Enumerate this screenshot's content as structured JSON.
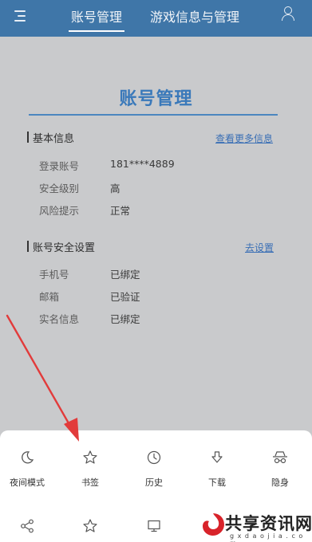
{
  "topbar": {
    "tabs": [
      {
        "label": "账号管理",
        "active": true
      },
      {
        "label": "游戏信息与管理",
        "active": false
      }
    ]
  },
  "main": {
    "title": "账号管理",
    "basic": {
      "heading": "基本信息",
      "link": "查看更多信息",
      "rows": [
        {
          "label": "登录账号",
          "value": "181****4889"
        },
        {
          "label": "安全级别",
          "value": "高"
        },
        {
          "label": "风险提示",
          "value": "正常"
        }
      ]
    },
    "security": {
      "heading": "账号安全设置",
      "link": "去设置",
      "rows": [
        {
          "label": "手机号",
          "value": "已绑定"
        },
        {
          "label": "邮箱",
          "value": "已验证"
        },
        {
          "label": "实名信息",
          "value": "已绑定"
        }
      ]
    }
  },
  "sheet": {
    "actions": [
      {
        "label": "夜间模式",
        "icon": "moon-icon"
      },
      {
        "label": "书签",
        "icon": "star-icon"
      },
      {
        "label": "历史",
        "icon": "clock-icon"
      },
      {
        "label": "下载",
        "icon": "download-icon"
      },
      {
        "label": "隐身",
        "icon": "incognito-icon"
      }
    ],
    "second_row_icons": [
      "share-icon",
      "star-outline-icon",
      "monitor-icon"
    ]
  },
  "watermark": {
    "text": "共享资讯网",
    "subtext": "g x d a o j i a . c o m"
  },
  "colors": {
    "topbar": "#3f76a8",
    "title": "#3a79ba",
    "link": "#3a6fb5",
    "arrow": "#e23b3b",
    "background": "#c9cacc"
  }
}
